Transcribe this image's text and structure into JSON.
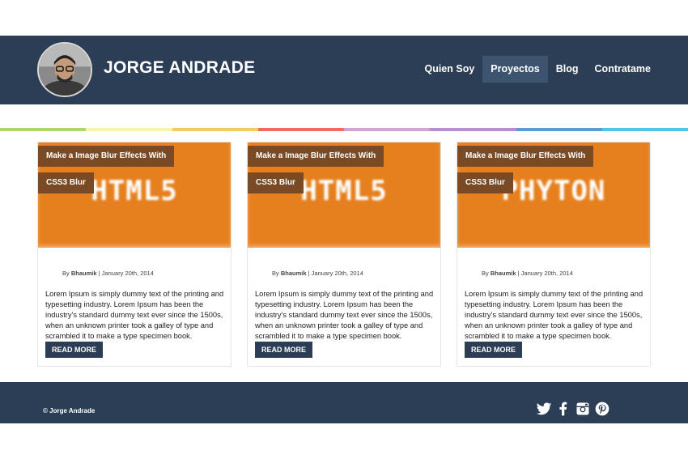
{
  "header": {
    "title": "JORGE ANDRADE",
    "nav": [
      {
        "label": "Quien Soy",
        "active": false
      },
      {
        "label": "Proyectos",
        "active": true
      },
      {
        "label": "Blog",
        "active": false
      },
      {
        "label": "Contratame",
        "active": false
      }
    ]
  },
  "rainbow_colors": [
    "#a9d86e",
    "#f8f3b0",
    "#f6c96b",
    "#ee6e5a",
    "#d6a0d9",
    "#b88bd6",
    "#5a9bd8",
    "#55c2ea"
  ],
  "cards": [
    {
      "image_word": "HTML5",
      "tag1": "Make a Image Blur Effects With",
      "tag2": "CSS3 Blur",
      "meta_by": "By",
      "author": "Bhaumik",
      "date": "| January 20th, 2014",
      "excerpt": "Lorem Ipsum is simply dummy text of the printing and typesetting industry. Lorem Ipsum has been the industry's standard dummy text ever since the 1500s, when an unknown printer took a galley of type and scrambled it to make a type specimen book.",
      "button": "READ MORE"
    },
    {
      "image_word": "HTML5",
      "tag1": "Make a Image Blur Effects With",
      "tag2": "CSS3 Blur",
      "meta_by": "By",
      "author": "Bhaumik",
      "date": "| January 20th, 2014",
      "excerpt": "Lorem Ipsum is simply dummy text of the printing and typesetting industry. Lorem Ipsum has been the industry's standard dummy text ever since the 1500s, when an unknown printer took a galley of type and scrambled it to make a type specimen book.",
      "button": "READ MORE"
    },
    {
      "image_word": "PHYTON",
      "tag1": "Make a Image Blur Effects With",
      "tag2": "CSS3 Blur",
      "meta_by": "By",
      "author": "Bhaumik",
      "date": "| January 20th, 2014",
      "excerpt": "Lorem Ipsum is simply dummy text of the printing and typesetting industry. Lorem Ipsum has been the industry's standard dummy text ever since the 1500s, when an unknown printer took a galley of type and scrambled it to make a type specimen book.",
      "button": "READ MORE"
    }
  ],
  "footer": {
    "copyright": "© Jorge Andrade",
    "social_icons": [
      "twitter-icon",
      "facebook-icon",
      "instagram-icon",
      "pinterest-icon"
    ]
  },
  "colors": {
    "brand": "#2c3e56",
    "card_image": "#e6801e",
    "tag": "#7a4a25"
  }
}
